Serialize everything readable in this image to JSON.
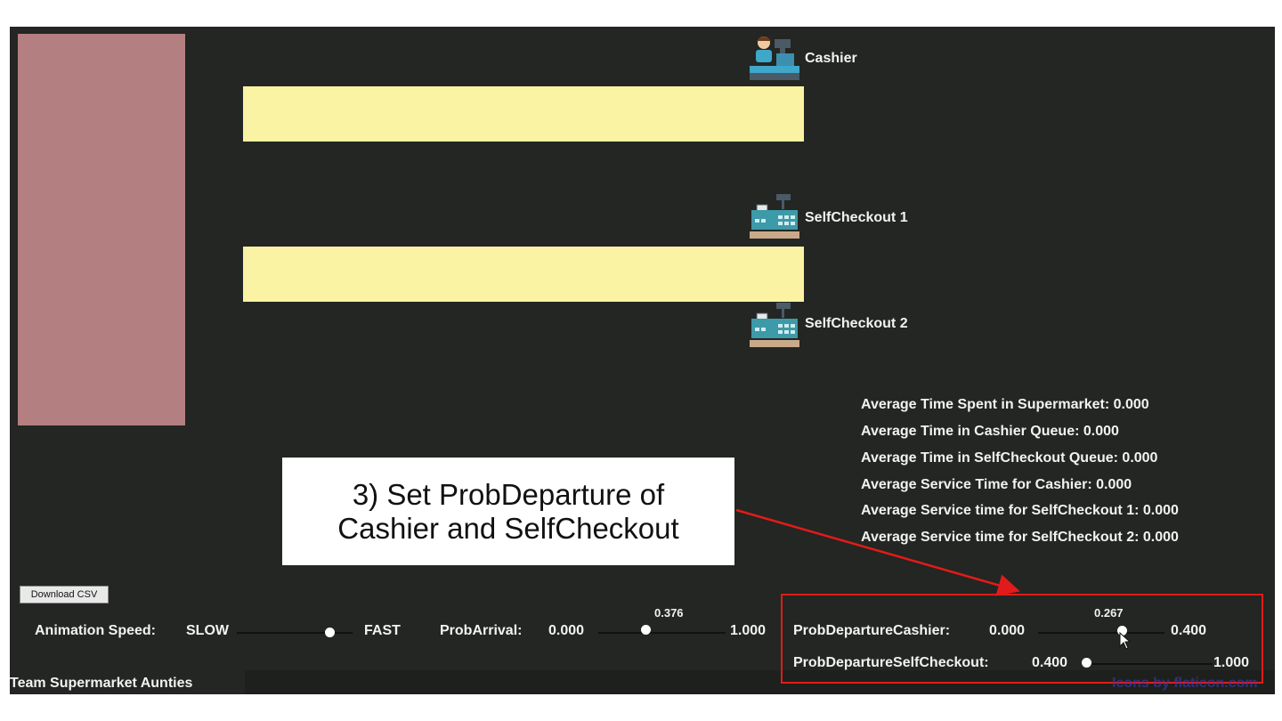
{
  "stations": {
    "cashier": "Cashier",
    "self1": "SelfCheckout 1",
    "self2": "SelfCheckout 2"
  },
  "stats": [
    "Average Time Spent in Supermarket: 0.000",
    "Average Time in Cashier Queue: 0.000",
    "Average Time in SelfCheckout Queue: 0.000",
    "Average Service Time for Cashier: 0.000",
    "Average Service time for SelfCheckout 1: 0.000",
    "Average Service time for SelfCheckout 2: 0.000"
  ],
  "callout": {
    "line1": "3) Set ProbDeparture of",
    "line2": "Cashier and SelfCheckout"
  },
  "download_button": "Download CSV",
  "controls": {
    "animation": {
      "label": "Animation Speed:",
      "min_label": "SLOW",
      "max_label": "FAST",
      "level": 0.8
    },
    "arrival": {
      "label": "ProbArrival:",
      "min": "0.000",
      "max": "1.000",
      "value": "0.376"
    },
    "departure_cashier": {
      "label": "ProbDepartureCashier:",
      "min": "0.000",
      "max": "0.400",
      "value": "0.267"
    },
    "departure_self": {
      "label": "ProbDepartureSelfCheckout:",
      "min": "0.400",
      "max": "1.000",
      "value": "0.400"
    }
  },
  "footer": {
    "team": "Team Supermarket Aunties",
    "credit": "Icons by flaticon.com"
  },
  "colors": {
    "background": "#232622",
    "store": "#b47f81",
    "queue": "#fbf3a4",
    "highlight": "#e11b1b"
  }
}
